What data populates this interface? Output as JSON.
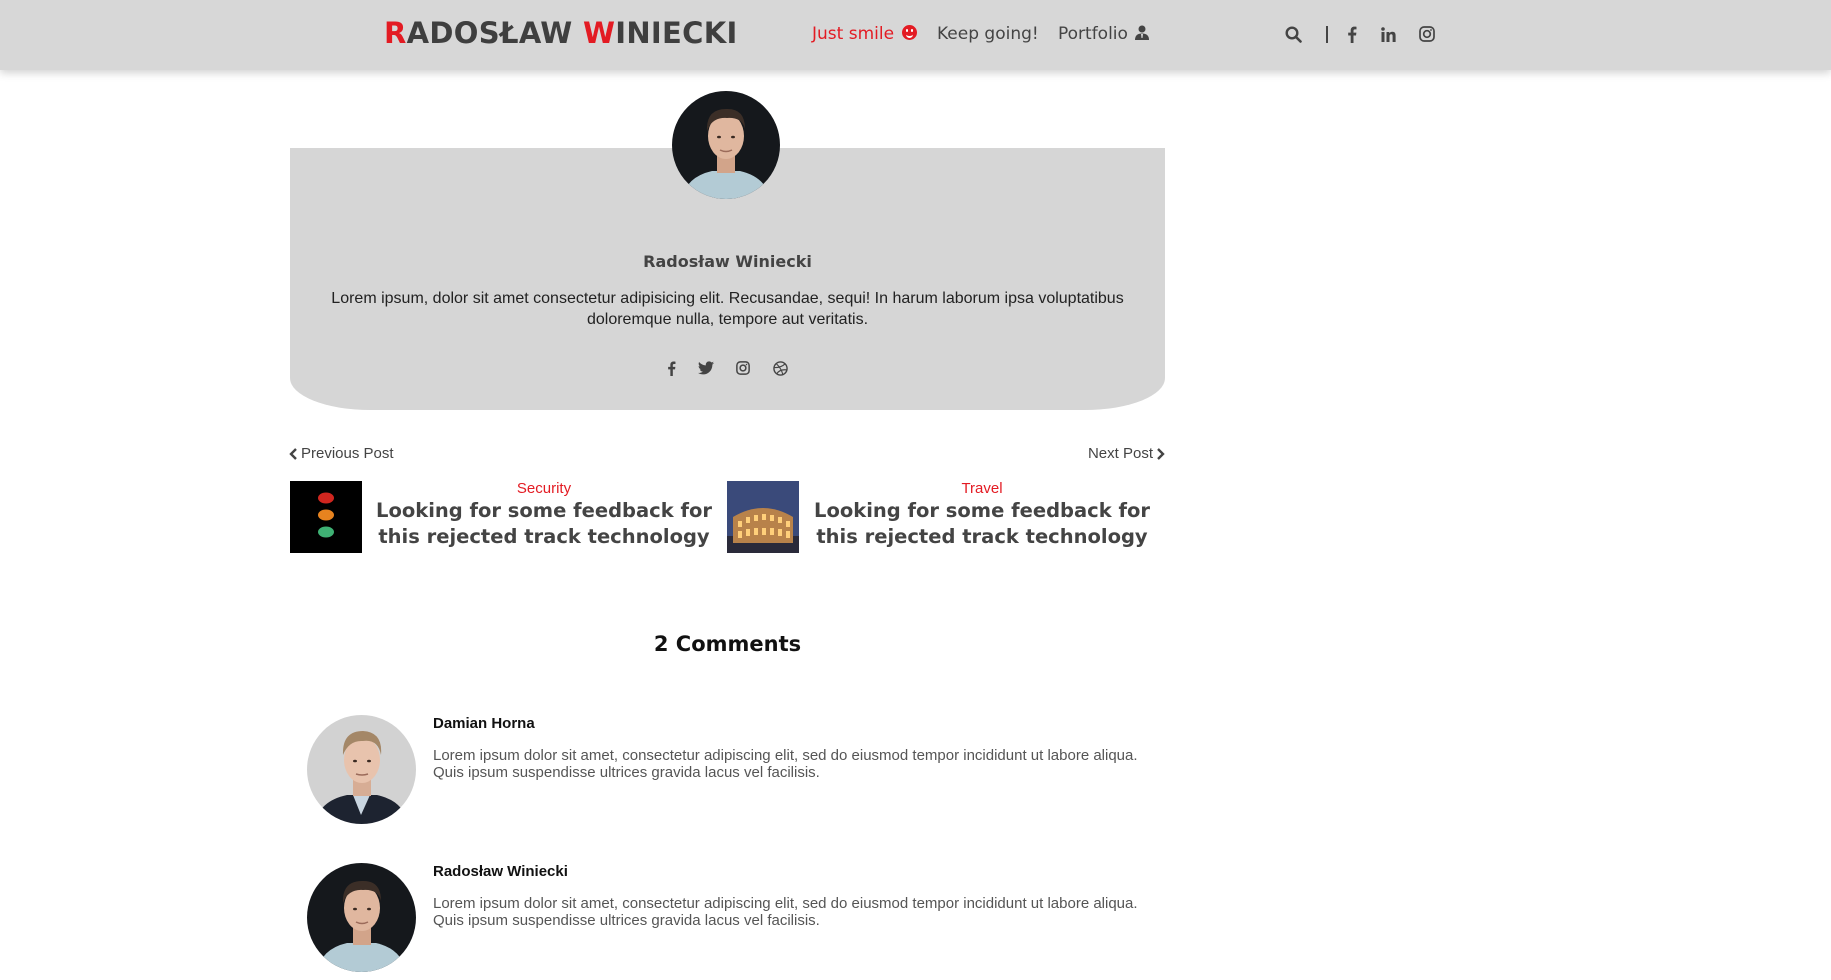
{
  "header": {
    "logo": {
      "first_initial": "R",
      "first_rest": "ADOSŁAW ",
      "second_initial": "W",
      "second_rest": "INIECKI"
    },
    "nav": [
      {
        "label": "Just smile",
        "icon": "smile-icon",
        "active": true
      },
      {
        "label": "Keep going!"
      },
      {
        "label": "Portfolio",
        "icon": "user-icon"
      }
    ],
    "icons": [
      "search-icon",
      "facebook-icon",
      "linkedin-icon",
      "instagram-icon"
    ]
  },
  "author": {
    "name": "Radosław Winiecki",
    "bio": "Lorem ipsum, dolor sit amet consectetur adipisicing elit. Recusandae, sequi! In harum laborum ipsa voluptatibus doloremque nulla, tempore aut veritatis.",
    "socials": [
      "facebook-icon",
      "twitter-icon",
      "instagram-icon",
      "dribbble-icon"
    ]
  },
  "post_nav": {
    "previous_label": "Previous Post",
    "next_label": "Next Post",
    "previous": {
      "category": "Security",
      "title": "Looking for some feedback for this rejected track technology"
    },
    "next": {
      "category": "Travel",
      "title": "Looking for some feedback for this rejected track technology"
    }
  },
  "comments": {
    "heading": "2 Comments",
    "items": [
      {
        "author": "Damian Horna",
        "text": "Lorem ipsum dolor sit amet, consectetur adipiscing elit, sed do eiusmod tempor incididunt ut labore aliqua. Quis ipsum suspendisse ultrices gravida lacus vel facilisis."
      },
      {
        "author": "Radosław Winiecki",
        "text": "Lorem ipsum dolor sit amet, consectetur adipiscing elit, sed do eiusmod tempor incididunt ut labore aliqua. Quis ipsum suspendisse ultrices gravida lacus vel facilisis."
      }
    ]
  },
  "colors": {
    "accent": "#e31b23",
    "header_bg": "#d7d7d7",
    "card_bg": "#d6d6d6",
    "text_dark": "#444444"
  }
}
